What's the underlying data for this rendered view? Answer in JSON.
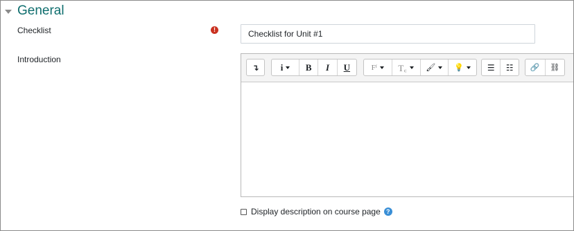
{
  "section": {
    "title": "General"
  },
  "fields": {
    "checklist_label": "Checklist",
    "checklist_value": "Checklist for Unit #1",
    "required_icon": "!",
    "intro_label": "Introduction"
  },
  "toolbar": {
    "toggle": "↴",
    "info": "i",
    "bold": "B",
    "italic": "I",
    "underline": "U",
    "font_family": "Fᶠ",
    "font_size": "T꜀",
    "brush": "🖌",
    "bulb": "💡",
    "bullet_list": "☰",
    "numbered_list": "☷",
    "link": "🔗",
    "unlink": "⛓"
  },
  "display_description": {
    "label": "Display description on course page",
    "checked": false,
    "help_icon": "?"
  },
  "colors": {
    "section_title": "#0f6e6e",
    "required": "#ca3120",
    "help": "#3a8fd6"
  }
}
